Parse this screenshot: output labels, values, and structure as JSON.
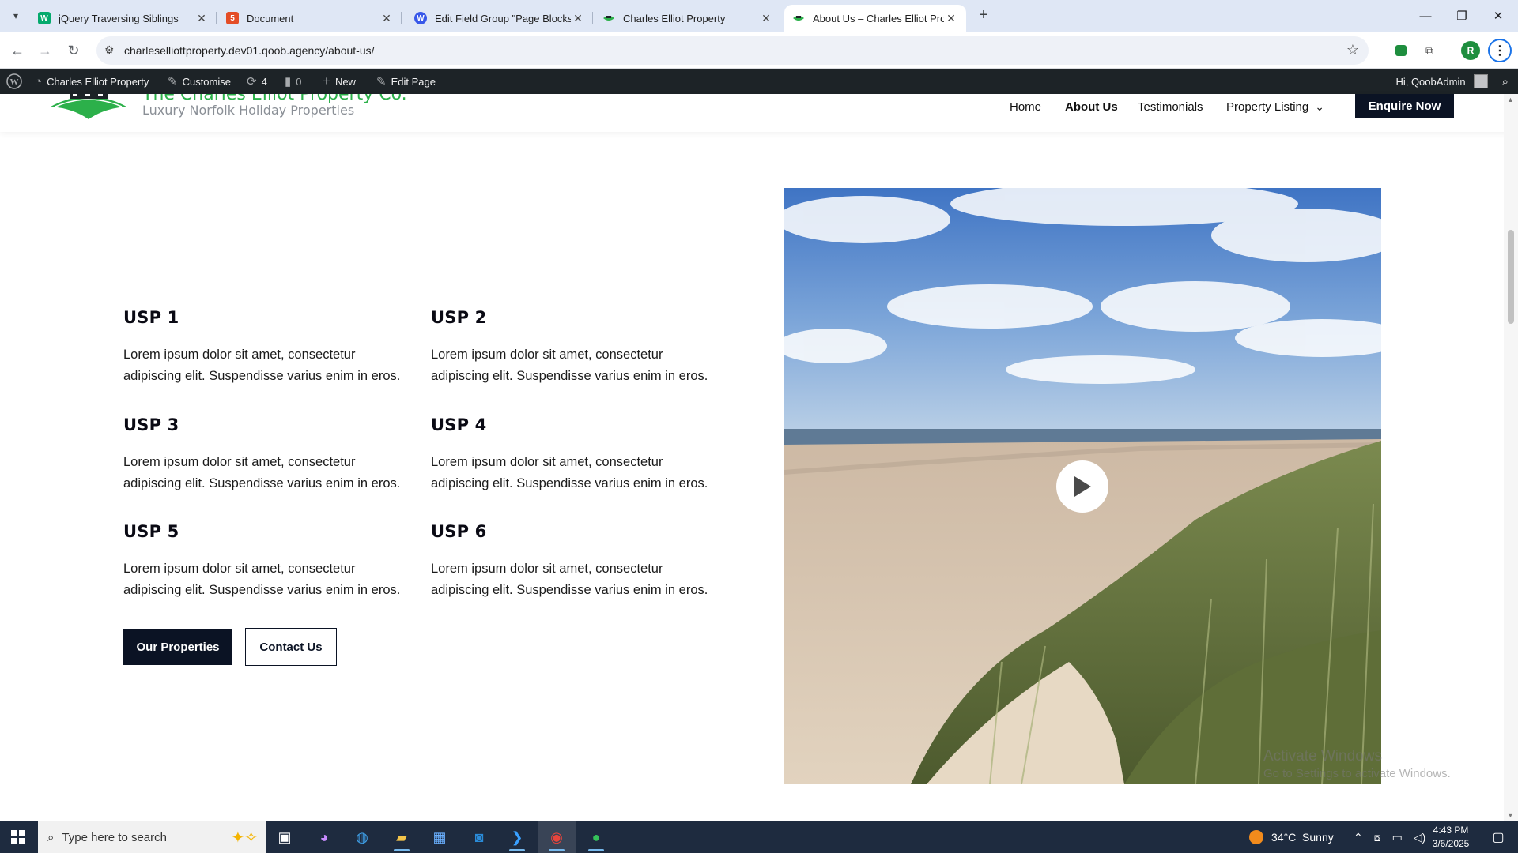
{
  "browser": {
    "tabs": [
      {
        "title": "jQuery Traversing Siblings",
        "favicon": "w3schools-icon",
        "favicon_text": "W",
        "favicon_color": "#04aa6d"
      },
      {
        "title": "Document",
        "favicon": "html-icon",
        "favicon_text": "5",
        "favicon_color": "#e44d26"
      },
      {
        "title": "Edit Field Group \"Page Blocks\" ‹",
        "favicon": "wordpress-icon",
        "favicon_text": "W",
        "favicon_color": "#3858e9"
      },
      {
        "title": "Charles Elliot Property",
        "favicon": "site-logo-icon",
        "favicon_text": "",
        "favicon_color": "#2cb04a"
      },
      {
        "title": "About Us – Charles Elliot Prope",
        "favicon": "site-logo-icon",
        "favicon_text": "",
        "favicon_color": "#2cb04a"
      }
    ],
    "url": "charleselliottproperty.dev01.qoob.agency/about-us/",
    "profile_initial": "R"
  },
  "admin_bar": {
    "site_name": "Charles Elliot Property",
    "customise": "Customise",
    "updates": "4",
    "comments": "0",
    "new": "New",
    "edit_page": "Edit Page",
    "greeting": "Hi, QoobAdmin"
  },
  "header": {
    "brand_name": "The Charles Elliot Property Co.",
    "tagline": "Luxury Norfolk Holiday Properties",
    "nav": [
      "Home",
      "About Us",
      "Testimonials",
      "Property Listing"
    ],
    "cta": "Enquire Now"
  },
  "usps": [
    {
      "title": "USP 1",
      "text": "Lorem ipsum dolor sit amet, consectetur adipiscing elit. Suspendisse varius enim in eros."
    },
    {
      "title": "USP 2",
      "text": "Lorem ipsum dolor sit amet, consectetur adipiscing elit. Suspendisse varius enim in eros."
    },
    {
      "title": "USP 3",
      "text": "Lorem ipsum dolor sit amet, consectetur adipiscing elit. Suspendisse varius enim in eros."
    },
    {
      "title": "USP 4",
      "text": "Lorem ipsum dolor sit amet, consectetur adipiscing elit. Suspendisse varius enim in eros."
    },
    {
      "title": "USP 5",
      "text": "Lorem ipsum dolor sit amet, consectetur adipiscing elit. Suspendisse varius enim in eros."
    },
    {
      "title": "USP 6",
      "text": "Lorem ipsum dolor sit amet, consectetur adipiscing elit. Suspendisse varius enim in eros."
    }
  ],
  "buttons": {
    "primary": "Our Properties",
    "secondary": "Contact Us"
  },
  "watermark": {
    "line1": "Activate Windows",
    "line2": "Go to Settings to activate Windows."
  },
  "taskbar": {
    "search_placeholder": "Type here to search",
    "weather": "34°C  Sunny",
    "time": "4:43 PM",
    "date": "3/6/2025"
  },
  "colors": {
    "brand_green": "#2cb04a",
    "navy": "#0b1324",
    "admin_bar": "#1d2327"
  }
}
